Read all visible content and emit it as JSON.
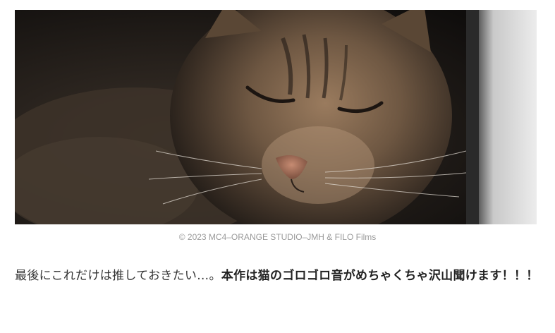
{
  "image": {
    "icon": "cat-photo",
    "caption": "© 2023 MC4–ORANGE STUDIO–JMH & FILO Films"
  },
  "article": {
    "text_normal": "最後にこれだけは推しておきたい…。",
    "text_bold": "本作は猫のゴロゴロ音がめちゃくちゃ沢山聞けます！！！"
  }
}
